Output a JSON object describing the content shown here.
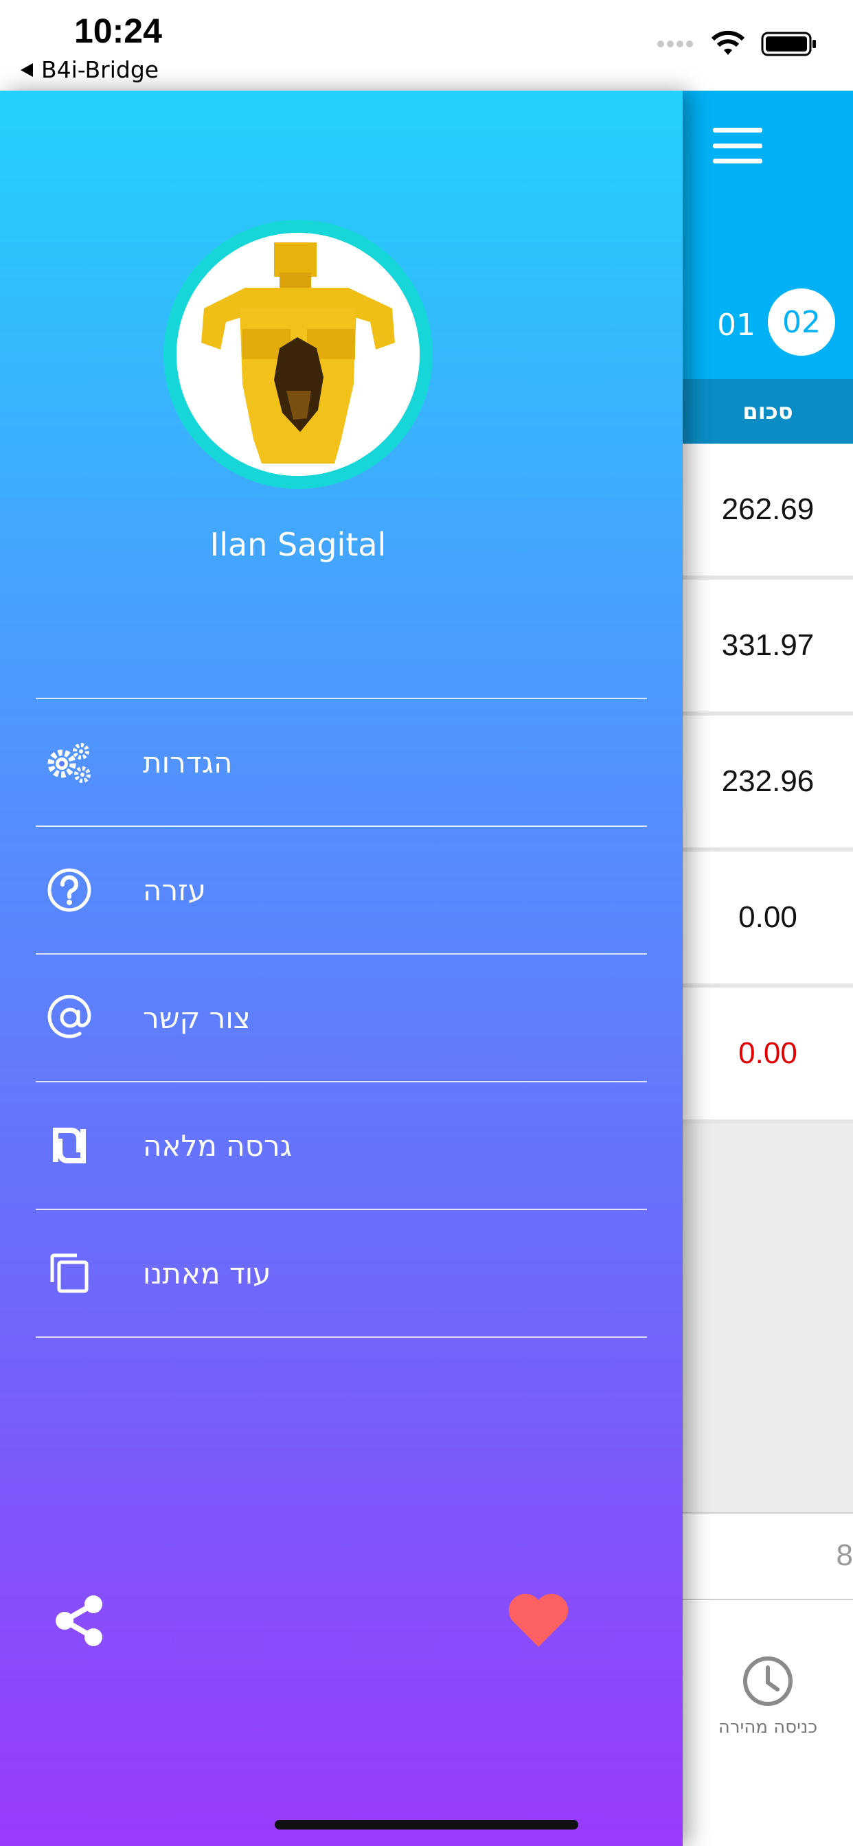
{
  "status_bar": {
    "time": "10:24",
    "back_app": "B4i-Bridge"
  },
  "drawer": {
    "user_name": "Ilan Sagital",
    "menu": [
      {
        "label": "הגדרות",
        "icon": "settings-gears-icon"
      },
      {
        "label": "עזרה",
        "icon": "help-icon"
      },
      {
        "label": "צור קשר",
        "icon": "at-sign-icon"
      },
      {
        "label": "גרסה מלאה",
        "icon": "shekel-icon"
      },
      {
        "label": "עוד מאתנו",
        "icon": "copy-apps-icon"
      }
    ],
    "share_icon": "share-icon",
    "heart_icon": "heart-icon",
    "heart_color": "#fb6161"
  },
  "main": {
    "accent_color": "#00b2f5",
    "months": [
      "01",
      "02"
    ],
    "selected_month": "02",
    "column_header": "סכום",
    "rows": [
      "262.69",
      "331.97",
      "232.96",
      "0.00",
      "0.00"
    ],
    "input_hint": "8",
    "quick_entry_label": "כניסה מהירה"
  }
}
